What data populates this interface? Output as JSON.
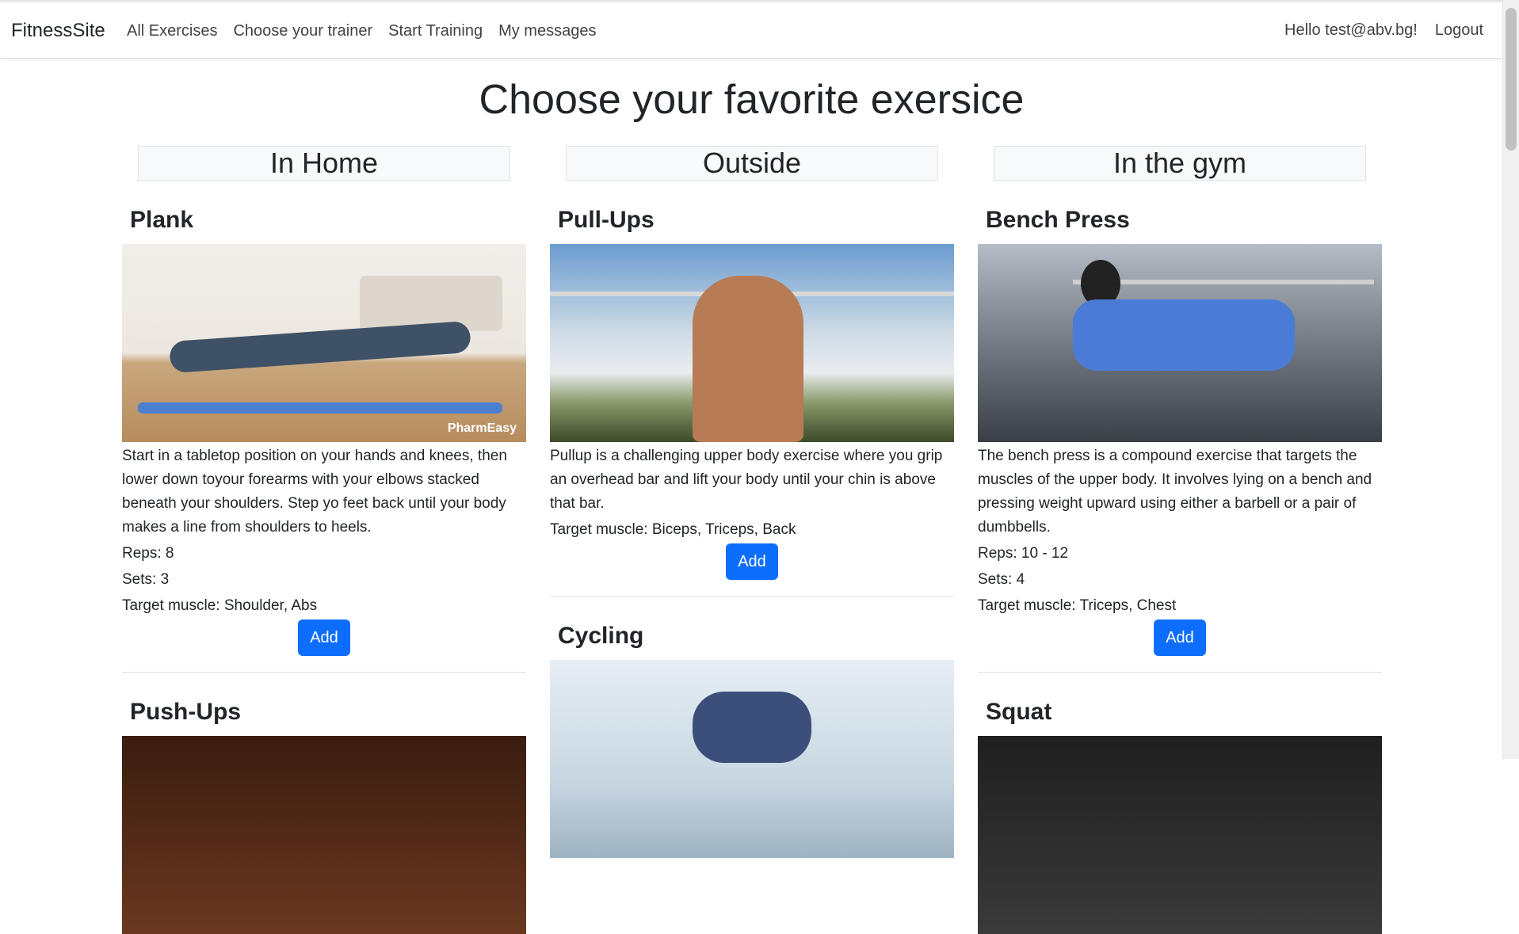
{
  "navbar": {
    "brand": "FitnessSite",
    "links": [
      "All Exercises",
      "Choose your trainer",
      "Start Training",
      "My messages"
    ],
    "greeting": "Hello test@abv.bg!",
    "logout": "Logout"
  },
  "page": {
    "title": "Choose your favorite exersice"
  },
  "columns": [
    {
      "header": "In Home",
      "exercises": [
        {
          "name": "Plank",
          "description": "Start in a tabletop position on your hands and knees, then lower down toyour forearms with your elbows stacked beneath your shoulders. Step yo feet back until your body makes a line from shoulders to heels.",
          "reps": "Reps: 8",
          "sets": "Sets: 3",
          "target": "Target muscle: Shoulder, Abs",
          "watermark": "PharmEasy",
          "add": "Add"
        },
        {
          "name": "Push-Ups"
        }
      ]
    },
    {
      "header": "Outside",
      "exercises": [
        {
          "name": "Pull-Ups",
          "description": "Pullup is a challenging upper body exercise where you grip an overhead bar and lift your body until your chin is above that bar.",
          "target": "Target muscle: Biceps, Triceps, Back",
          "add": "Add"
        },
        {
          "name": "Cycling"
        }
      ]
    },
    {
      "header": "In the gym",
      "exercises": [
        {
          "name": "Bench Press",
          "description": "The bench press is a compound exercise that targets the muscles of the upper body. It involves lying on a bench and pressing weight upward using either a barbell or a pair of dumbbells.",
          "reps": "Reps: 10 - 12",
          "sets": "Sets: 4",
          "target": "Target muscle: Triceps, Chest",
          "add": "Add"
        },
        {
          "name": "Squat"
        }
      ]
    }
  ],
  "colors": {
    "primary": "#0d6efd",
    "header_bg": "#f8f9fa",
    "text": "#212529"
  }
}
